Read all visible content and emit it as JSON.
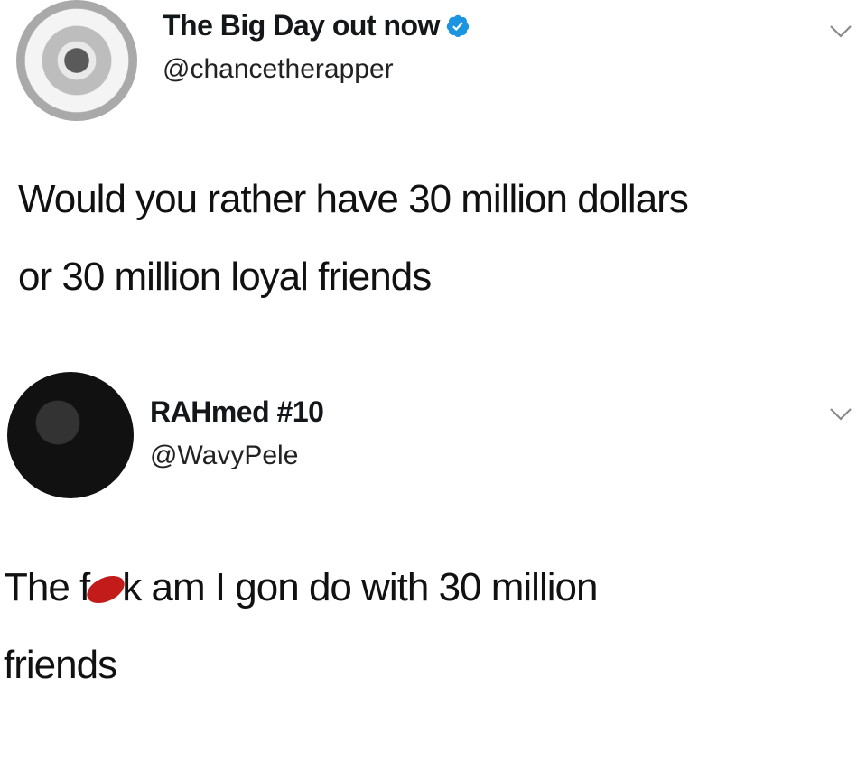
{
  "tweets": [
    {
      "display_name": "The Big Day out now",
      "verified": true,
      "handle": "@chancetherapper",
      "text": "Would you rather have 30 million dollars\nor 30 million loyal friends",
      "avatar_icon": "album-disc-avatar",
      "menu_icon": "chevron-down-icon"
    },
    {
      "display_name": "RAHmed #10",
      "verified": false,
      "handle": "@WavyPele",
      "text_before_censor": "The f",
      "text_after_censor": "k am I gon do with 30 million\nfriends",
      "avatar_icon": "dark-photo-avatar",
      "menu_icon": "chevron-down-icon"
    }
  ],
  "colors": {
    "background": "#ffffff",
    "text": "#14171a",
    "verified_blue": "#1b95e0",
    "censor_red": "#c31a1a"
  }
}
